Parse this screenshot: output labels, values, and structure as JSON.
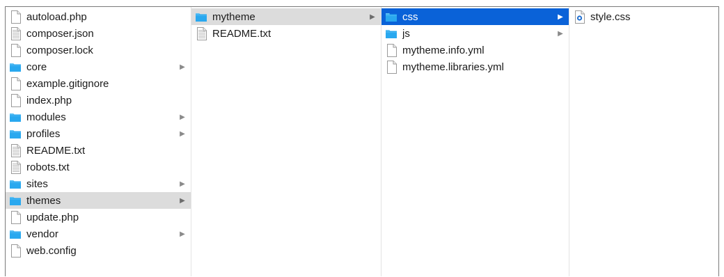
{
  "columns": [
    {
      "items": [
        {
          "label": "autoload.php",
          "icon": "file-icon"
        },
        {
          "label": "composer.json",
          "icon": "text-file-icon"
        },
        {
          "label": "composer.lock",
          "icon": "file-icon"
        },
        {
          "label": "core",
          "icon": "folder-icon",
          "has_children": true
        },
        {
          "label": "example.gitignore",
          "icon": "file-icon"
        },
        {
          "label": "index.php",
          "icon": "file-icon"
        },
        {
          "label": "modules",
          "icon": "folder-icon",
          "has_children": true
        },
        {
          "label": "profiles",
          "icon": "folder-icon",
          "has_children": true
        },
        {
          "label": "README.txt",
          "icon": "text-file-icon"
        },
        {
          "label": "robots.txt",
          "icon": "text-file-icon"
        },
        {
          "label": "sites",
          "icon": "folder-icon",
          "has_children": true
        },
        {
          "label": "themes",
          "icon": "folder-icon",
          "has_children": true,
          "state": "path"
        },
        {
          "label": "update.php",
          "icon": "file-icon"
        },
        {
          "label": "vendor",
          "icon": "folder-icon",
          "has_children": true
        },
        {
          "label": "web.config",
          "icon": "file-icon"
        }
      ]
    },
    {
      "items": [
        {
          "label": "mytheme",
          "icon": "folder-icon",
          "has_children": true,
          "state": "path"
        },
        {
          "label": "README.txt",
          "icon": "text-file-icon"
        }
      ]
    },
    {
      "items": [
        {
          "label": "css",
          "icon": "folder-icon",
          "has_children": true,
          "state": "selected"
        },
        {
          "label": "js",
          "icon": "folder-icon",
          "has_children": true
        },
        {
          "label": "mytheme.info.yml",
          "icon": "file-icon"
        },
        {
          "label": "mytheme.libraries.yml",
          "icon": "file-icon"
        }
      ]
    },
    {
      "items": [
        {
          "label": "style.css",
          "icon": "css-file-icon"
        }
      ]
    }
  ],
  "colors": {
    "folder": "#29a8ef",
    "folder_tab": "#5cc0f5",
    "selection_active": "#0a62d8",
    "selection_path": "#dcdcdc"
  }
}
